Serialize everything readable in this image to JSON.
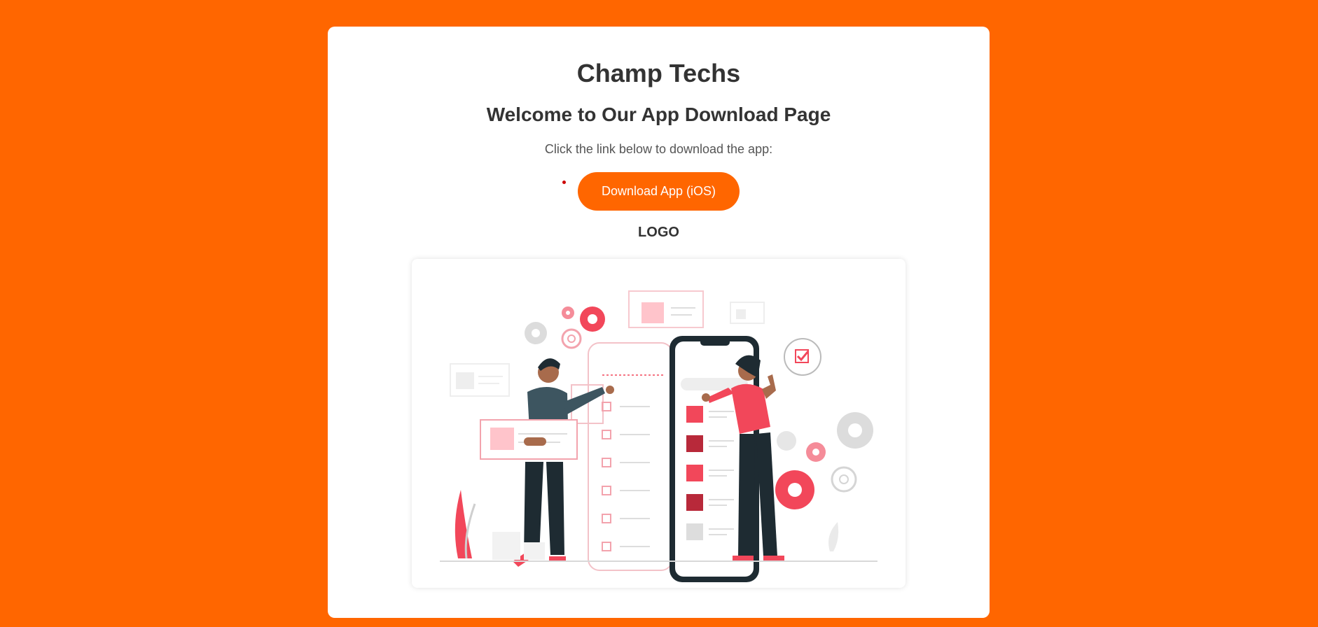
{
  "page": {
    "title": "Champ Techs",
    "subtitle": "Welcome to Our App Download Page",
    "instruction": "Click the link below to download the app:",
    "download_label": "Download App (iOS)",
    "logo_label": "LOGO"
  },
  "illustration": {
    "icon": "mobile-app-development-illustration"
  },
  "colors": {
    "background": "#ff6600",
    "card": "#ffffff",
    "accent": "#ff6600",
    "heading": "#333333",
    "illustration_red": "#f2475a",
    "illustration_dark": "#1e2b32"
  }
}
